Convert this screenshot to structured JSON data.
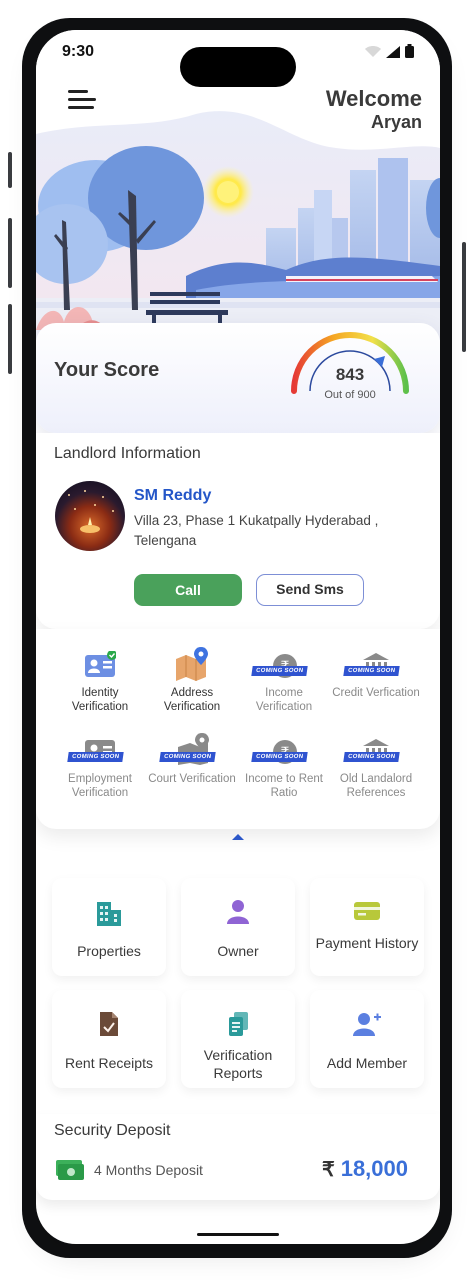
{
  "status": {
    "time": "9:30"
  },
  "header": {
    "welcome": "Welcome",
    "user_name": "Aryan",
    "menu_icon": "menu-icon"
  },
  "score": {
    "title": "Your Score",
    "value": "843",
    "out_of": "Out of 900",
    "fraction": 0.937
  },
  "landlord": {
    "section_title": "Landlord Information",
    "name": "SM Reddy",
    "address": "Villa 23, Phase 1 Kukatpally Hyderabad , Telengana",
    "call_label": "Call",
    "sms_label": "Send Sms"
  },
  "verifications": {
    "coming_soon_label": "COMING SOON",
    "items": [
      {
        "label": "Identity Verification",
        "icon": "id-card-icon",
        "enabled": true,
        "verified": true
      },
      {
        "label": "Address Verification",
        "icon": "map-pin-icon",
        "enabled": true
      },
      {
        "label": "Income Verification",
        "icon": "rupee-coin-icon",
        "enabled": false
      },
      {
        "label": "Credit Verfication",
        "icon": "bank-icon",
        "enabled": false
      },
      {
        "label": "Employment Verification",
        "icon": "id-card-icon",
        "enabled": false
      },
      {
        "label": "Court Verification",
        "icon": "court-icon",
        "enabled": false
      },
      {
        "label": "Income to Rent Ratio",
        "icon": "rupee-coin-icon",
        "enabled": false
      },
      {
        "label": "Old Landalord References",
        "icon": "bank-icon",
        "enabled": false
      }
    ]
  },
  "tiles": [
    {
      "label": "Properties",
      "icon": "building-icon",
      "bg": "#e6f4f4",
      "color": "#2a9a9a"
    },
    {
      "label": "Owner",
      "icon": "person-icon",
      "bg": "#ece6f8",
      "color": "#8f64d4"
    },
    {
      "label": "Payment History",
      "icon": "card-icon",
      "bg": "#f1f6df",
      "color": "#b8c83a"
    },
    {
      "label": "Rent Receipts",
      "icon": "receipt-icon",
      "bg": "#fcf1ea",
      "color": "#6b4a38"
    },
    {
      "label": "Verification Reports",
      "icon": "reports-icon",
      "bg": "#e6f4f4",
      "color": "#2a9a9a"
    },
    {
      "label": "Add Member",
      "icon": "add-user-icon",
      "bg": "#dde5fb",
      "color": "#5b7fe0"
    }
  ],
  "deposit": {
    "title": "Security Deposit",
    "description": "4 Months Deposit",
    "currency": "₹",
    "amount": "18,000"
  }
}
